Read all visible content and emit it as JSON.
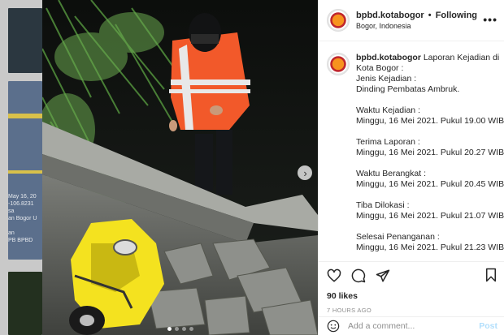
{
  "backdrop": {
    "caption_lines": "May 16, 20\n-106.8231\nsa\nan Bogor U\n\nan\nPB BPBD"
  },
  "post": {
    "username": "bpbd.kotabogor",
    "separator": "•",
    "follow_status": "Following",
    "location": "Bogor, Indonesia",
    "more_icon": "more-horizontal-icon",
    "caption": {
      "username": "bpbd.kotabogor",
      "lines": [
        "Laporan Kejadian di",
        "Kota Bogor :",
        "Jenis Kejadian :",
        "Dinding Pembatas Ambruk.",
        "",
        "Waktu Kejadian :",
        "Minggu, 16 Mei 2021. Pukul 19.00 WIB.",
        "",
        "Terima Laporan :",
        "Minggu, 16 Mei 2021. Pukul 20.27 WIB.",
        "",
        "Waktu Berangkat :",
        "Minggu, 16 Mei 2021. Pukul 20.45 WIB.",
        "",
        "Tiba Dilokasi :",
        "Minggu, 16 Mei 2021. Pukul 21.07 WIB.",
        "",
        "Selesai Penanganan :",
        "Minggu, 16 Mei 2021. Pukul 21.23 WIB."
      ]
    },
    "likes": "90 likes",
    "timestamp": "7 HOURS AGO",
    "comment_placeholder": "Add a comment...",
    "post_label": "Post",
    "carousel": {
      "count": 4,
      "active_index": 0
    }
  },
  "icons": {
    "next": "chevron-right-icon",
    "like": "heart-icon",
    "comment": "comment-icon",
    "share": "share-icon",
    "save": "bookmark-icon",
    "emoji": "emoji-icon"
  },
  "colors": {
    "vest": "#f2592a",
    "vest_stripe": "#e8e8e8",
    "scooter": "#f4e21f",
    "post_button": "#b2dffc",
    "muted_text": "#8e8e8e"
  }
}
